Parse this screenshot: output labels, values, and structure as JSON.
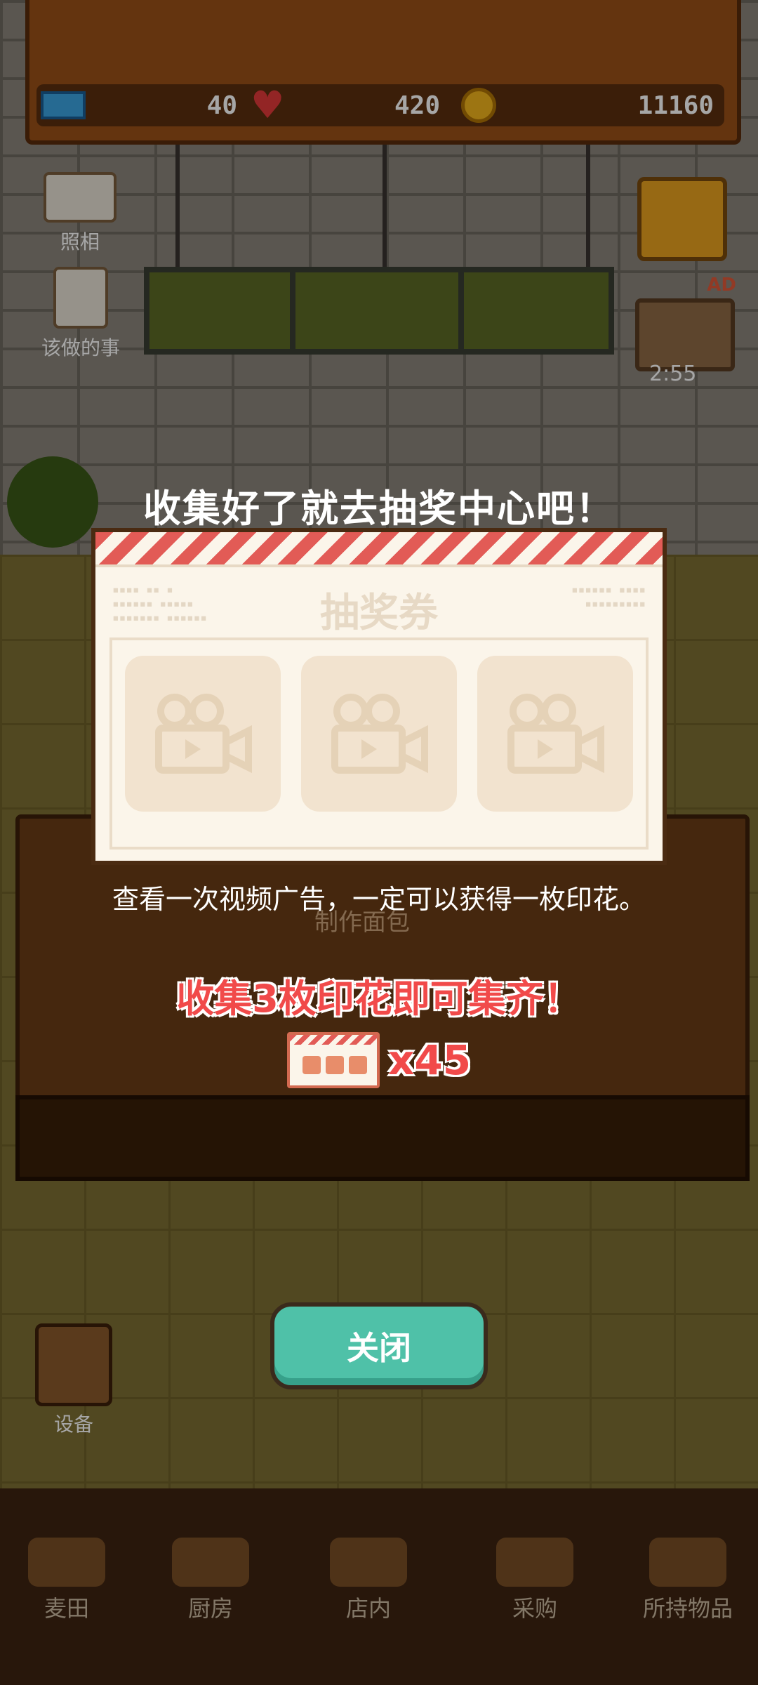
{
  "resources": {
    "tickets": "40",
    "hearts": "420",
    "coins": "11160"
  },
  "side": {
    "camera_label": "照相",
    "todo_label": "该做的事",
    "ad_badge": "AD",
    "ad_timer": "2:55",
    "equipment_label": "设备"
  },
  "scene": {
    "table_label": "制作面包"
  },
  "modal": {
    "headline": "收集好了就去抽奖中心吧！",
    "card_title": "抽奖券",
    "description": "查看一次视频广告，一定可以获得一枚印花。",
    "collect_hint": "收集3枚印花即可集齐！",
    "ticket_count": "x45",
    "close_label": "关闭"
  },
  "bottom_nav": [
    {
      "label": "麦田",
      "icon": "wheat-field-icon"
    },
    {
      "label": "厨房",
      "icon": "kitchen-icon"
    },
    {
      "label": "店内",
      "icon": "store-icon"
    },
    {
      "label": "采购",
      "icon": "purchase-icon"
    },
    {
      "label": "所持物品",
      "icon": "inventory-icon"
    }
  ],
  "colors": {
    "accent_red": "#f14a4a",
    "close_button": "#4fc1a8",
    "card_bg": "#fbf5ea"
  }
}
